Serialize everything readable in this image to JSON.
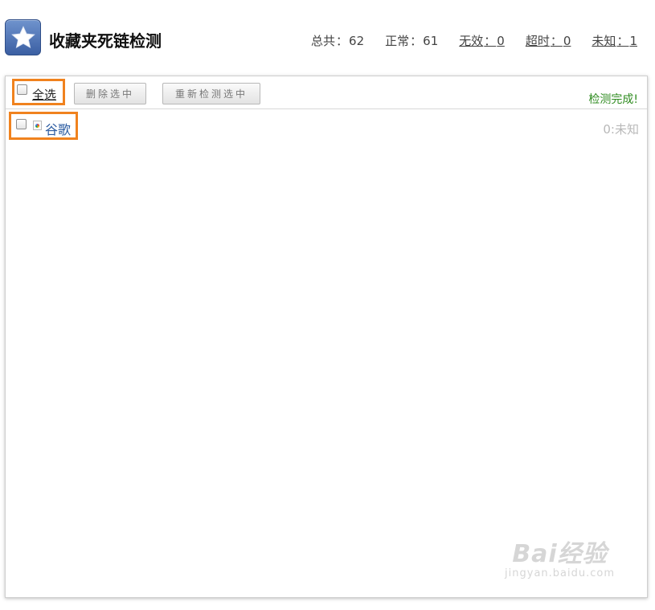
{
  "header": {
    "title": "收藏夹死链检测",
    "logo_icon": "star-icon",
    "stats": [
      {
        "label": "总共",
        "value": "62"
      },
      {
        "label": "正常",
        "value": "61"
      },
      {
        "label": "无效",
        "value": "0"
      },
      {
        "label": "超时",
        "value": "0"
      },
      {
        "label": "未知",
        "value": "1"
      }
    ]
  },
  "toolbar": {
    "select_all_label": "全选",
    "delete_selected_label": "删除选中",
    "recheck_selected_label": "重新检测选中",
    "status_text": "检测完成!"
  },
  "list": {
    "items": [
      {
        "title": "谷歌",
        "favicon": "google-favicon-icon",
        "status": "0:未知"
      }
    ]
  },
  "watermark": {
    "main": "Bai经验",
    "sub": "jingyan.baidu.com"
  },
  "colors": {
    "highlight": "#f0821e",
    "status_done": "#2e8b1f",
    "link": "#2a5aa0"
  }
}
